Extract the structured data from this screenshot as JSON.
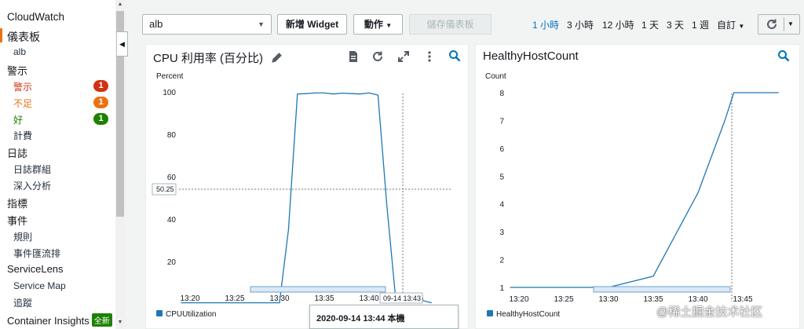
{
  "sidebar": {
    "brand": "CloudWatch",
    "dashboards": "儀表板",
    "dashboard_item": "alb",
    "alarms": "警示",
    "alarm_alarm": "警示",
    "alarm_alarm_count": "1",
    "alarm_insufficient": "不足",
    "alarm_insufficient_count": "1",
    "alarm_ok": "好",
    "alarm_ok_count": "1",
    "billing": "計費",
    "logs": "日誌",
    "log_groups": "日誌群組",
    "insights": "深入分析",
    "metrics": "指標",
    "events": "事件",
    "rules": "規則",
    "event_buses": "事件匯流排",
    "servicelens": "ServiceLens",
    "service_map": "Service Map",
    "traces": "追蹤",
    "container_insights": "Container Insights",
    "new_tag": "全新",
    "colors": {
      "alarm": "#d13212",
      "insufficient": "#ec7211",
      "ok": "#1d8102",
      "active": "#ec7211"
    }
  },
  "toolbar": {
    "dashboard_select": "alb",
    "add_widget": "新增 Widget",
    "actions": "動作",
    "save_dashboard": "儲存儀表板",
    "time_ranges": [
      "1 小時",
      "3 小時",
      "12 小時",
      "1 天",
      "3 天",
      "1 週",
      "自訂"
    ],
    "active_range": "1 小時",
    "refresh_icon": "refresh-icon"
  },
  "widgets": [
    {
      "title": "CPU 利用率 (百分比)",
      "unit": "Percent",
      "legend": "CPUUtilization",
      "crosshair_value": "50.25",
      "crosshair_time": "09-14 13:43",
      "icons": [
        "edit-icon",
        "document-icon",
        "refresh-icon",
        "expand-icon",
        "more-icon",
        "zoom-icon"
      ]
    },
    {
      "title": "HealthyHostCount",
      "unit": "Count",
      "legend": "HealthyHostCount",
      "icons": [
        "zoom-icon"
      ]
    }
  ],
  "tooltip": "2020-09-14 13:44 本機",
  "watermark": "@稀土掘金技术社区",
  "chart_data": [
    {
      "type": "line",
      "title": "CPU 利用率 (百分比)",
      "ylabel": "Percent",
      "ylim": [
        0,
        100
      ],
      "yticks": [
        20,
        40,
        60,
        80,
        100
      ],
      "xticks": [
        "13:20",
        "13:25",
        "13:30",
        "13:35",
        "13:40",
        "13:45"
      ],
      "x": [
        "13:19",
        "13:30",
        "13:31",
        "13:32",
        "13:33",
        "13:34",
        "13:35",
        "13:36",
        "13:37",
        "13:38",
        "13:39",
        "13:40",
        "13:41",
        "13:42",
        "13:43",
        "13:44",
        "13:45",
        "13:46",
        "13:47"
      ],
      "series": [
        {
          "name": "CPUUtilization",
          "color": "#1f77b4",
          "values": [
            0.5,
            0.5,
            35,
            99,
            99.2,
            99.5,
            99.5,
            99,
            99.4,
            99.2,
            99,
            99.5,
            98.5,
            46,
            1.5,
            0.5,
            0.5,
            1.5,
            0.5
          ]
        }
      ]
    },
    {
      "type": "line",
      "title": "HealthyHostCount",
      "ylabel": "Count",
      "ylim": [
        1,
        8
      ],
      "yticks": [
        1,
        2,
        3,
        4,
        5,
        6,
        7,
        8
      ],
      "xticks": [
        "13:20",
        "13:25",
        "13:30",
        "13:35",
        "13:40",
        "13:45"
      ],
      "x": [
        "13:19",
        "13:29",
        "13:30",
        "13:35",
        "13:40",
        "13:43",
        "13:44",
        "13:45",
        "13:49"
      ],
      "series": [
        {
          "name": "HealthyHostCount",
          "color": "#1f77b4",
          "values": [
            1,
            1,
            1,
            1.4,
            4.4,
            7,
            8,
            8,
            8
          ]
        }
      ]
    }
  ]
}
